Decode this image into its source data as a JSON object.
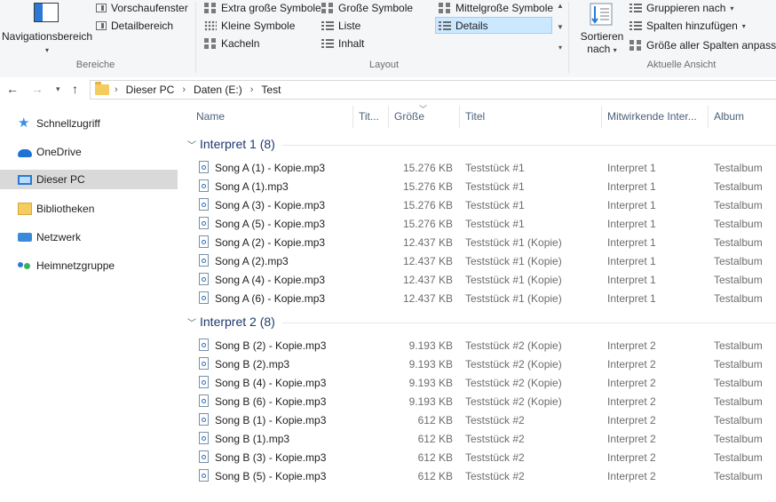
{
  "ribbon": {
    "bereiche": {
      "navigation_pane_label": "Navigationsbereich",
      "preview_label": "Vorschaufenster",
      "details_pane_label": "Detailbereich",
      "group_label": "Bereiche"
    },
    "layout": {
      "group_label": "Layout",
      "options": {
        "extra_large": "Extra große Symbole",
        "large": "Große Symbole",
        "medium": "Mittelgroße Symbole",
        "small": "Kleine Symbole",
        "list": "Liste",
        "details": "Details",
        "tiles": "Kacheln",
        "content": "Inhalt"
      },
      "selected": "Details"
    },
    "current_view": {
      "group_label": "Aktuelle Ansicht",
      "sort_line1": "Sortieren",
      "sort_line2": "nach",
      "group_by": "Gruppieren nach",
      "add_columns": "Spalten hinzufügen",
      "fit_columns": "Größe aller Spalten anpassen"
    }
  },
  "address": {
    "crumbs": [
      "Dieser PC",
      "Daten (E:)",
      "Test"
    ]
  },
  "nav": {
    "items": [
      {
        "label": "Schnellzugriff",
        "icon": "star-icon"
      },
      {
        "label": "OneDrive",
        "icon": "cloud-icon"
      },
      {
        "label": "Dieser PC",
        "icon": "computer-icon",
        "selected": true
      },
      {
        "label": "Bibliotheken",
        "icon": "library-icon"
      },
      {
        "label": "Netzwerk",
        "icon": "network-icon"
      },
      {
        "label": "Heimnetzgruppe",
        "icon": "homegroup-icon"
      }
    ]
  },
  "columns": {
    "name": "Name",
    "track": "Tit...",
    "size": "Größe",
    "title": "Titel",
    "artists": "Mitwirkende Inter...",
    "album": "Album"
  },
  "groups": [
    {
      "title": "Interpret 1 (8)",
      "rows": [
        {
          "name": "Song A (1) - Kopie.mp3",
          "size": "15.276 KB",
          "title": "Teststück #1",
          "artist": "Interpret 1",
          "album": "Testalbum"
        },
        {
          "name": "Song A (1).mp3",
          "size": "15.276 KB",
          "title": "Teststück #1",
          "artist": "Interpret 1",
          "album": "Testalbum"
        },
        {
          "name": "Song A (3) - Kopie.mp3",
          "size": "15.276 KB",
          "title": "Teststück #1",
          "artist": "Interpret 1",
          "album": "Testalbum"
        },
        {
          "name": "Song A (5) - Kopie.mp3",
          "size": "15.276 KB",
          "title": "Teststück #1",
          "artist": "Interpret 1",
          "album": "Testalbum"
        },
        {
          "name": "Song A (2) - Kopie.mp3",
          "size": "12.437 KB",
          "title": "Teststück #1 (Kopie)",
          "artist": "Interpret 1",
          "album": "Testalbum"
        },
        {
          "name": "Song A (2).mp3",
          "size": "12.437 KB",
          "title": "Teststück #1 (Kopie)",
          "artist": "Interpret 1",
          "album": "Testalbum"
        },
        {
          "name": "Song A (4) - Kopie.mp3",
          "size": "12.437 KB",
          "title": "Teststück #1 (Kopie)",
          "artist": "Interpret 1",
          "album": "Testalbum"
        },
        {
          "name": "Song A (6) - Kopie.mp3",
          "size": "12.437 KB",
          "title": "Teststück #1 (Kopie)",
          "artist": "Interpret 1",
          "album": "Testalbum"
        }
      ]
    },
    {
      "title": "Interpret 2 (8)",
      "rows": [
        {
          "name": "Song B (2) - Kopie.mp3",
          "size": "9.193 KB",
          "title": "Teststück #2 (Kopie)",
          "artist": "Interpret 2",
          "album": "Testalbum"
        },
        {
          "name": "Song B (2).mp3",
          "size": "9.193 KB",
          "title": "Teststück #2 (Kopie)",
          "artist": "Interpret 2",
          "album": "Testalbum"
        },
        {
          "name": "Song B (4) - Kopie.mp3",
          "size": "9.193 KB",
          "title": "Teststück #2 (Kopie)",
          "artist": "Interpret 2",
          "album": "Testalbum"
        },
        {
          "name": "Song B (6) - Kopie.mp3",
          "size": "9.193 KB",
          "title": "Teststück #2 (Kopie)",
          "artist": "Interpret 2",
          "album": "Testalbum"
        },
        {
          "name": "Song B (1) - Kopie.mp3",
          "size": "612 KB",
          "title": "Teststück #2",
          "artist": "Interpret 2",
          "album": "Testalbum"
        },
        {
          "name": "Song B (1).mp3",
          "size": "612 KB",
          "title": "Teststück #2",
          "artist": "Interpret 2",
          "album": "Testalbum"
        },
        {
          "name": "Song B (3) - Kopie.mp3",
          "size": "612 KB",
          "title": "Teststück #2",
          "artist": "Interpret 2",
          "album": "Testalbum"
        },
        {
          "name": "Song B (5) - Kopie.mp3",
          "size": "612 KB",
          "title": "Teststück #2",
          "artist": "Interpret 2",
          "album": "Testalbum"
        }
      ]
    }
  ],
  "colors": {
    "group_title": "#1e3a6e",
    "selection": "#cce8ff",
    "nav_selected": "#d9d9d9"
  }
}
